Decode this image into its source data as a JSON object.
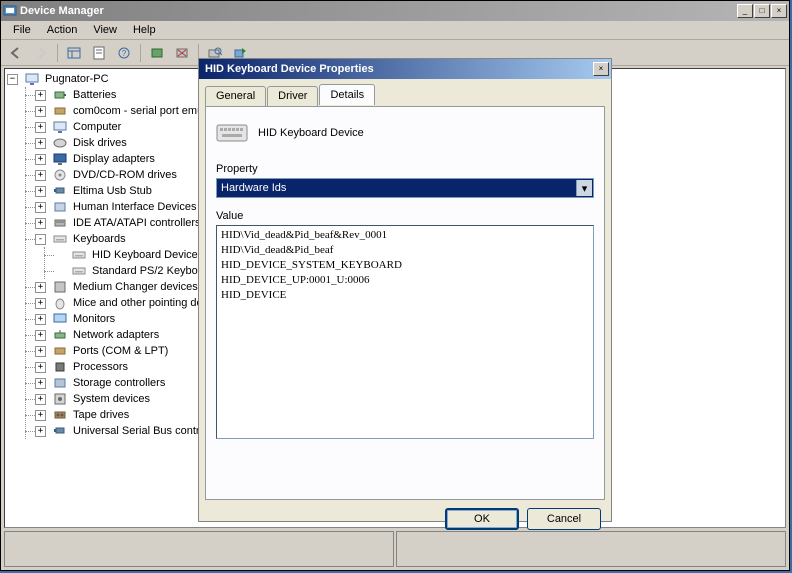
{
  "main": {
    "title": "Device Manager",
    "menus": [
      "File",
      "Action",
      "View",
      "Help"
    ],
    "root": "Pugnator-PC",
    "devices": [
      {
        "label": "Batteries",
        "icon": "battery",
        "exp": "+"
      },
      {
        "label": "com0com - serial port emul",
        "icon": "port",
        "exp": "+"
      },
      {
        "label": "Computer",
        "icon": "computer",
        "exp": "+"
      },
      {
        "label": "Disk drives",
        "icon": "disk",
        "exp": "+"
      },
      {
        "label": "Display adapters",
        "icon": "display",
        "exp": "+"
      },
      {
        "label": "DVD/CD-ROM drives",
        "icon": "cd",
        "exp": "+"
      },
      {
        "label": "Eltima Usb Stub",
        "icon": "usb",
        "exp": "+"
      },
      {
        "label": "Human Interface Devices",
        "icon": "hid",
        "exp": "+"
      },
      {
        "label": "IDE ATA/ATAPI controllers",
        "icon": "ide",
        "exp": "+"
      },
      {
        "label": "Keyboards",
        "icon": "keyboard",
        "exp": "-",
        "children": [
          {
            "label": "HID Keyboard Device",
            "icon": "keyboard"
          },
          {
            "label": "Standard PS/2 Keyboa",
            "icon": "keyboard"
          }
        ]
      },
      {
        "label": "Medium Changer devices",
        "icon": "medium",
        "exp": "+"
      },
      {
        "label": "Mice and other pointing de",
        "icon": "mouse",
        "exp": "+"
      },
      {
        "label": "Monitors",
        "icon": "monitor",
        "exp": "+"
      },
      {
        "label": "Network adapters",
        "icon": "network",
        "exp": "+"
      },
      {
        "label": "Ports (COM & LPT)",
        "icon": "port",
        "exp": "+"
      },
      {
        "label": "Processors",
        "icon": "cpu",
        "exp": "+"
      },
      {
        "label": "Storage controllers",
        "icon": "storage",
        "exp": "+"
      },
      {
        "label": "System devices",
        "icon": "system",
        "exp": "+"
      },
      {
        "label": "Tape drives",
        "icon": "tape",
        "exp": "+"
      },
      {
        "label": "Universal Serial Bus contro",
        "icon": "usb",
        "exp": "+"
      }
    ]
  },
  "dialog": {
    "title": "HID Keyboard Device Properties",
    "tabs": [
      "General",
      "Driver",
      "Details"
    ],
    "active_tab": 2,
    "device_name": "HID Keyboard Device",
    "property_label": "Property",
    "property_selected": "Hardware Ids",
    "value_label": "Value",
    "values": [
      "HID\\Vid_dead&Pid_beaf&Rev_0001",
      "HID\\Vid_dead&Pid_beaf",
      "HID_DEVICE_SYSTEM_KEYBOARD",
      "HID_DEVICE_UP:0001_U:0006",
      "HID_DEVICE"
    ],
    "ok": "OK",
    "cancel": "Cancel"
  }
}
